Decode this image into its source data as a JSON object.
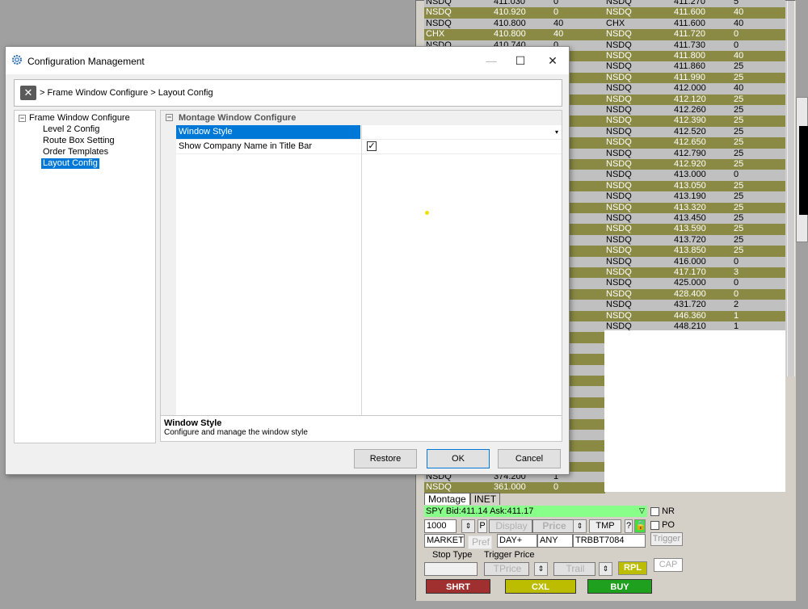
{
  "dialog": {
    "title": "Configuration Management",
    "breadcrumb": "> Frame Window Configure > Layout Config",
    "minimize": "—",
    "maximize": "☐",
    "close": "✕",
    "tree": {
      "root": "Frame Window Configure",
      "root_toggle": "⊟",
      "children": [
        "Level 2 Config",
        "Route Box Setting",
        "Order Templates",
        "Layout Config"
      ]
    },
    "grid": {
      "category": "Montage Window Configure",
      "category_toggle": "⊟",
      "rows": [
        {
          "name": "Window Style",
          "value": ""
        },
        {
          "name": "Show Company Name in Title Bar",
          "value": "✓"
        }
      ],
      "dropdown_arrow": "▾"
    },
    "description": {
      "title": "Window Style",
      "text": "Configure and manage the window style"
    },
    "buttons": {
      "restore": "Restore",
      "ok": "OK",
      "cancel": "Cancel"
    }
  },
  "montage": {
    "bid_rows": [
      [
        "NSDQ",
        "411.030",
        "0"
      ],
      [
        "NSDQ",
        "410.920",
        "0"
      ],
      [
        "NSDQ",
        "410.800",
        "40"
      ],
      [
        "CHX",
        "410.800",
        "40"
      ],
      [
        "NSDQ",
        "410.740",
        "0"
      ]
    ],
    "bid_rows_bottom": [
      [
        "NSDQ",
        "374.200",
        "1"
      ],
      [
        "NSDQ",
        "361.000",
        "0"
      ]
    ],
    "ask_rows": [
      [
        "NSDQ",
        "411.270",
        "5"
      ],
      [
        "NSDQ",
        "411.600",
        "40"
      ],
      [
        "CHX",
        "411.600",
        "40"
      ],
      [
        "NSDQ",
        "411.720",
        "0"
      ],
      [
        "NSDQ",
        "411.730",
        "0"
      ],
      [
        "NSDQ",
        "411.800",
        "40"
      ],
      [
        "NSDQ",
        "411.860",
        "25"
      ],
      [
        "NSDQ",
        "411.990",
        "25"
      ],
      [
        "NSDQ",
        "412.000",
        "40"
      ],
      [
        "NSDQ",
        "412.120",
        "25"
      ],
      [
        "NSDQ",
        "412.260",
        "25"
      ],
      [
        "NSDQ",
        "412.390",
        "25"
      ],
      [
        "NSDQ",
        "412.520",
        "25"
      ],
      [
        "NSDQ",
        "412.650",
        "25"
      ],
      [
        "NSDQ",
        "412.790",
        "25"
      ],
      [
        "NSDQ",
        "412.920",
        "25"
      ],
      [
        "NSDQ",
        "413.000",
        "0"
      ],
      [
        "NSDQ",
        "413.050",
        "25"
      ],
      [
        "NSDQ",
        "413.190",
        "25"
      ],
      [
        "NSDQ",
        "413.320",
        "25"
      ],
      [
        "NSDQ",
        "413.450",
        "25"
      ],
      [
        "NSDQ",
        "413.590",
        "25"
      ],
      [
        "NSDQ",
        "413.720",
        "25"
      ],
      [
        "NSDQ",
        "413.850",
        "25"
      ],
      [
        "NSDQ",
        "416.000",
        "0"
      ],
      [
        "NSDQ",
        "417.170",
        "3"
      ],
      [
        "NSDQ",
        "425.000",
        "0"
      ],
      [
        "NSDQ",
        "428.400",
        "0"
      ],
      [
        "NSDQ",
        "431.720",
        "2"
      ],
      [
        "NSDQ",
        "446.360",
        "1"
      ],
      [
        "NSDQ",
        "448.210",
        "1"
      ]
    ],
    "tabs": [
      "Montage",
      "INET"
    ],
    "symbol_line": "SPY Bid:411.14 Ask:411.17",
    "nr_label": "NR",
    "po_label": "PO",
    "quantity": "1000",
    "p_label": "P",
    "display_placeholder": "Display",
    "price_placeholder": "Price",
    "tmp_label": "TMP",
    "help_label": "?",
    "order_type": "MARKET",
    "pref_placeholder": "Pref",
    "tif": "DAY+",
    "any": "ANY",
    "account": "TRBBT7084",
    "trigger_button": "Trigger",
    "stop_type_label": "Stop Type",
    "trigger_price_label": "Trigger Price",
    "tprice_placeholder": "TPrice",
    "trail_placeholder": "Trail",
    "rpl_label": "RPL",
    "cap_label": "CAP",
    "shrt_label": "SHRT",
    "cxl_label": "CXL",
    "buy_label": "BUY",
    "colors": {
      "olive": "#8a8a44",
      "symbol_bar": "#88ff88",
      "shrt": "#a03030",
      "cxl": "#bcbc00",
      "buy": "#1fa01f"
    }
  }
}
